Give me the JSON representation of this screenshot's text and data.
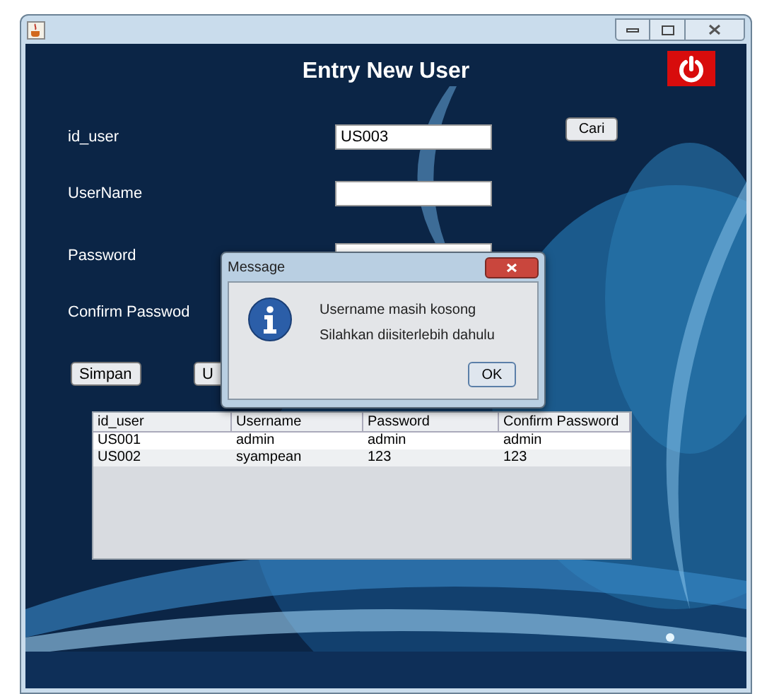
{
  "form": {
    "title": "Entry New User",
    "fields": [
      {
        "label": "id_user",
        "kind": "input",
        "value": "US003"
      },
      {
        "label": "UserName",
        "kind": "input"
      },
      {
        "label": "Password",
        "kind": "input"
      },
      {
        "label": "Confirm Passwod",
        "kind": "label"
      }
    ],
    "search_button": "Cari",
    "buttons": [
      "Simpan",
      "U"
    ]
  },
  "table": {
    "columns": [
      "id_user",
      "Username",
      "Password",
      "Confirm Password"
    ],
    "rows": [
      [
        "US001",
        "admin",
        "admin",
        "admin"
      ],
      [
        "US002",
        "syampean",
        "123",
        "123"
      ]
    ]
  },
  "dialog": {
    "title": "Message",
    "lines": [
      "Username masih kosong",
      "Silahkan diisiterlebih dahulu"
    ],
    "button": "OK"
  }
}
